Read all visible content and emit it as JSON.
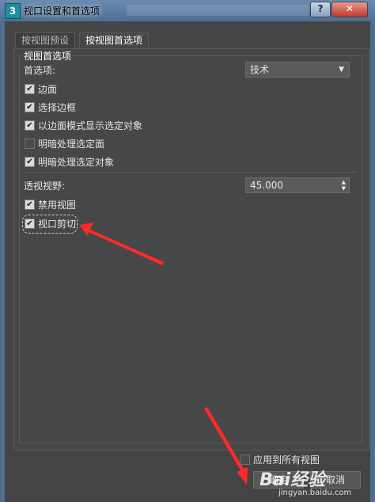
{
  "window": {
    "app_icon": "3",
    "title": "视口设置和首选项",
    "help": "?",
    "close": "✕"
  },
  "tabs": [
    {
      "label": "按视图预设"
    },
    {
      "label": "按视图首选项"
    }
  ],
  "group": {
    "title": "视图首选项"
  },
  "preference": {
    "label": "首选项:",
    "value": "技术"
  },
  "checks": [
    {
      "label": "边面",
      "checked": true
    },
    {
      "label": "选择边框",
      "checked": true
    },
    {
      "label": "以边面模式显示选定对象",
      "checked": true
    },
    {
      "label": "明暗处理选定面",
      "checked": false
    },
    {
      "label": "明暗处理选定对象",
      "checked": true
    }
  ],
  "fov": {
    "label": "透视视野:",
    "value": "45.000"
  },
  "checks2": [
    {
      "label": "禁用视图",
      "checked": true
    },
    {
      "label": "视口剪切",
      "checked": true
    }
  ],
  "apply_all": {
    "label": "应用到所有视图",
    "checked": false
  },
  "buttons": {
    "ok": "确定",
    "cancel": "取消"
  },
  "watermark": {
    "text": "Bai经验",
    "url": "jingyan.baidu.com"
  },
  "colors": {
    "annotation_arrow": "#ff2a2a"
  }
}
